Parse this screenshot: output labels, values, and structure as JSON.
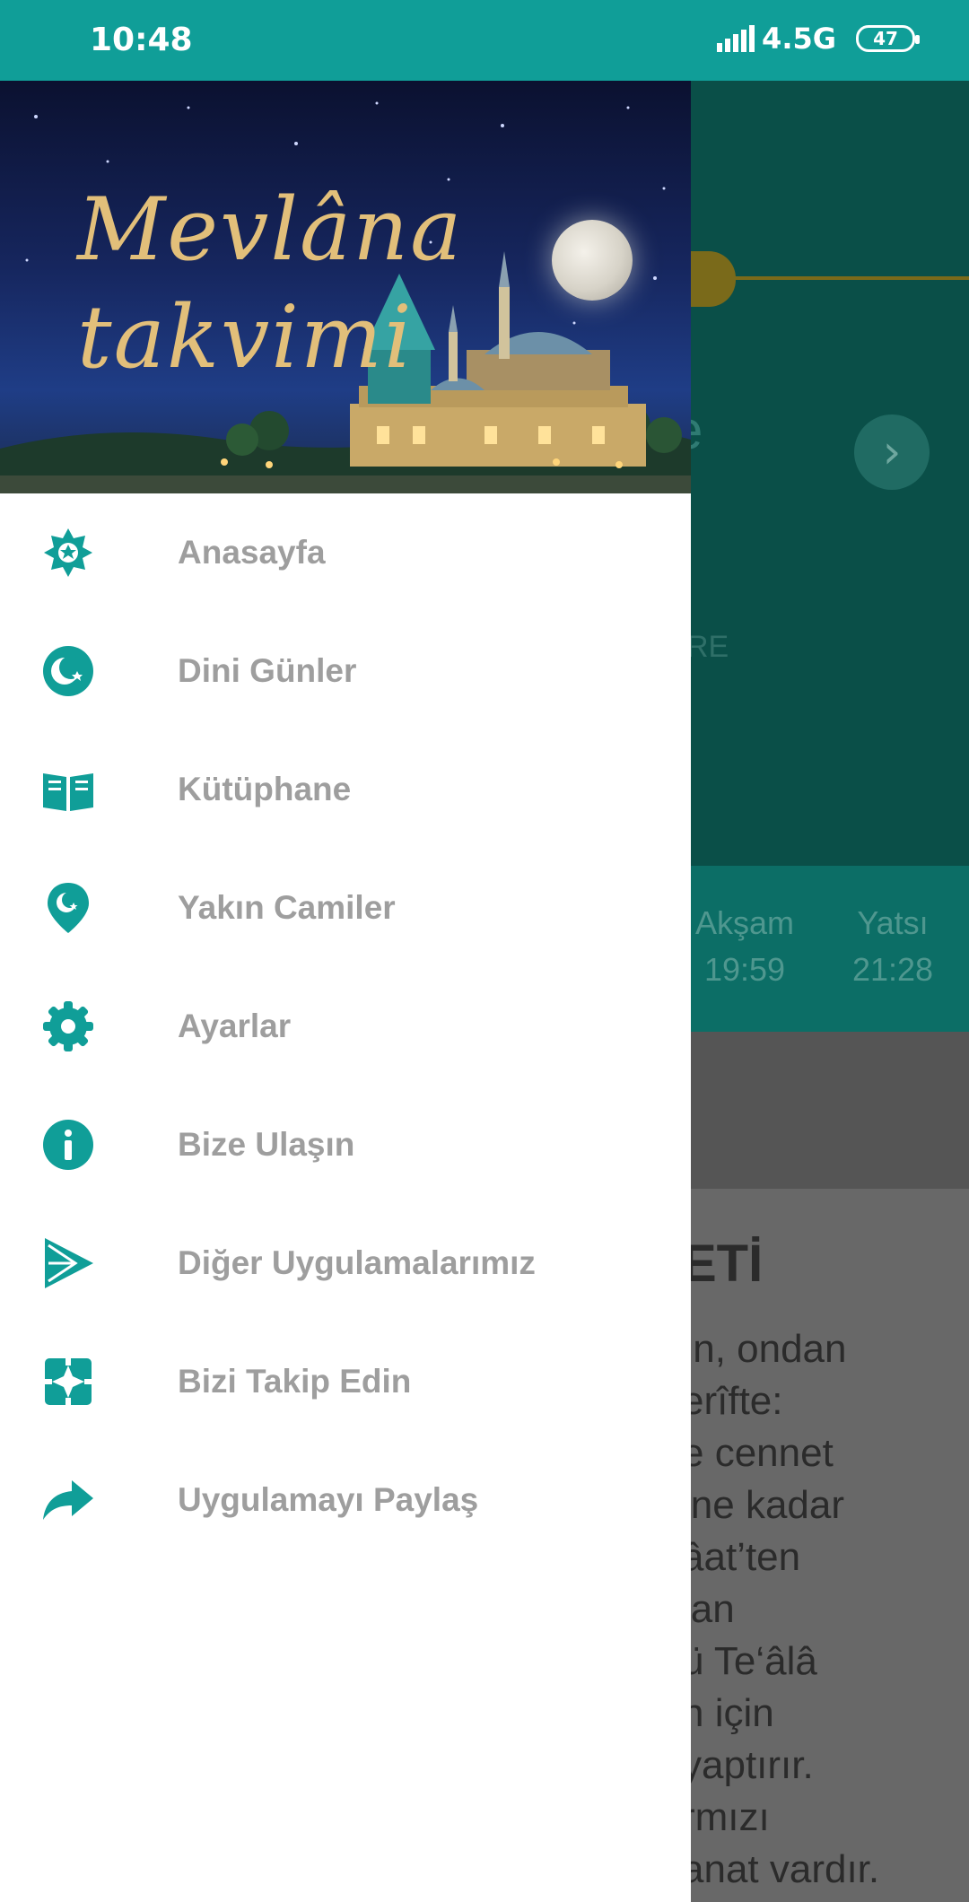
{
  "status_bar": {
    "time": "10:48",
    "network": "4.5G",
    "battery": "47"
  },
  "drawer": {
    "header": {
      "logo_line1": "Mevlâna",
      "logo_line2": "takvimi"
    },
    "accent_color": "#109e98",
    "items": [
      {
        "label": "Anasayfa",
        "icon": "star-ornament-icon"
      },
      {
        "label": "Dini Günler",
        "icon": "crescent-moon-icon"
      },
      {
        "label": "Kütüphane",
        "icon": "open-book-icon"
      },
      {
        "label": "Yakın Camiler",
        "icon": "location-pin-icon"
      },
      {
        "label": "Ayarlar",
        "icon": "gear-icon"
      },
      {
        "label": "Bize Ulaşın",
        "icon": "info-icon"
      },
      {
        "label": "Diğer Uygulamalarımız",
        "icon": "play-store-icon"
      },
      {
        "label": "Bizi Takip Edin",
        "icon": "follow-icon"
      },
      {
        "label": "Uygulamayı Paylaş",
        "icon": "share-arrow-icon"
      }
    ]
  },
  "background": {
    "partial_title": "e",
    "partial_label": "RE",
    "prayer_times": [
      {
        "name": "Akşam",
        "time": "19:59"
      },
      {
        "name": "Yatsı",
        "time": "21:28"
      }
    ],
    "article_title_partial": "ETİ",
    "article_lines_partial": [
      "ın, ondan",
      "erîfte:",
      "e cennet",
      "ine kadar",
      "âat’ten",
      "lan",
      "ü Te‘âlâ",
      "n için",
      "yaptırır.",
      "rmızı",
      "anat vardır."
    ]
  }
}
